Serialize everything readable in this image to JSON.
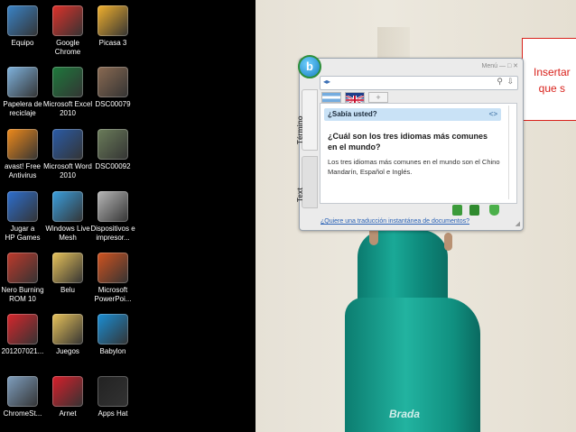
{
  "desktop": {
    "icons": [
      {
        "label": "Equipo",
        "icon": "computer-icon",
        "color": "#3a84c9"
      },
      {
        "label": "Google Chrome",
        "icon": "chrome-icon",
        "color": "#e0312a"
      },
      {
        "label": "Picasa 3",
        "icon": "picasa-icon",
        "color": "#f2b12d"
      },
      {
        "label": "Papelera de reciclaje",
        "icon": "recycle-bin-icon",
        "color": "#7fb3de"
      },
      {
        "label": "Microsoft Excel 2010",
        "icon": "excel-icon",
        "color": "#1d7a3c"
      },
      {
        "label": "DSC00079",
        "icon": "photo-icon",
        "color": "#8a6a52"
      },
      {
        "label": "avast! Free Antivirus",
        "icon": "avast-icon",
        "color": "#f08a1a"
      },
      {
        "label": "Microsoft Word 2010",
        "icon": "word-icon",
        "color": "#2a5ca8"
      },
      {
        "label": "DSC00092",
        "icon": "photo-icon",
        "color": "#6b7d5a"
      },
      {
        "label": "Jugar a HP Games",
        "icon": "hp-games-icon",
        "color": "#2d6fd1"
      },
      {
        "label": "Windows Live Mesh",
        "icon": "live-mesh-icon",
        "color": "#3aa0e0"
      },
      {
        "label": "Dispositivos e impresor...",
        "icon": "printer-icon",
        "color": "#b8b8b8"
      },
      {
        "label": "Nero Burning ROM 10",
        "icon": "nero-icon",
        "color": "#c0392b"
      },
      {
        "label": "Belu",
        "icon": "folder-icon",
        "color": "#e8c35a"
      },
      {
        "label": "Microsoft PowerPoi...",
        "icon": "powerpoint-icon",
        "color": "#d2531f"
      },
      {
        "label": "201207021...",
        "icon": "app-icon",
        "color": "#d9262c"
      },
      {
        "label": "Juegos",
        "icon": "folder-icon",
        "color": "#e8c35a"
      },
      {
        "label": "Babylon",
        "icon": "babylon-icon",
        "color": "#1a8fd6"
      },
      {
        "label": "ChromeSt...",
        "icon": "chrome-setup-icon",
        "color": "#7f9fbf"
      },
      {
        "label": "Arnet",
        "icon": "arnet-icon",
        "color": "#d91e2a"
      },
      {
        "label": "Apps Hat",
        "icon": "apps-hat-icon",
        "color": "#222222"
      }
    ]
  },
  "babylon": {
    "logo": "b",
    "menu": "Menú  —  □  ✕",
    "search_value": "",
    "tabs": [
      "Término",
      "Text"
    ],
    "did_you_know": "¿Sabía usted?",
    "did_nav": "<>",
    "question": "¿Cuál son los tres idiomas más comunes en el mundo?",
    "answer": "Los tres idiomas más comunes en el mundo son el Chino Mandarín, Español e Inglés.",
    "footer_link": "¿Quiere una traducción instantánea de documentos?",
    "add_tab": "+"
  },
  "callout": {
    "line1": "Insertar",
    "line2": "que s"
  },
  "wallpaper": {
    "watermark": "Brada"
  }
}
